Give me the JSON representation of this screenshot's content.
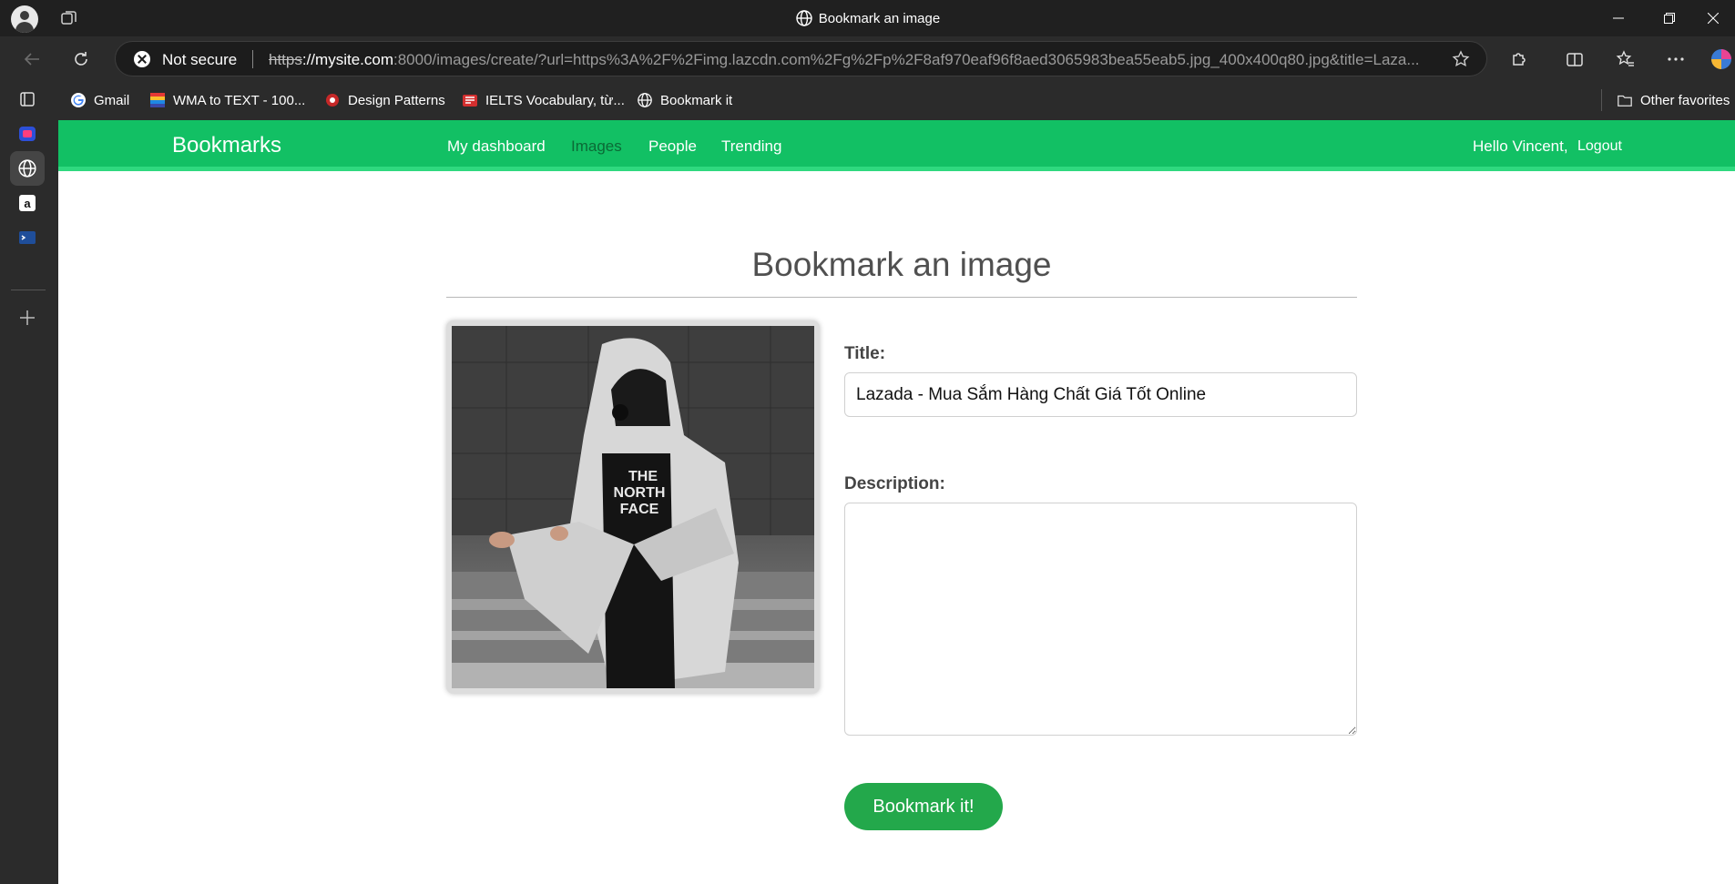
{
  "window": {
    "title": "Bookmark an image"
  },
  "address_bar": {
    "security_label": "Not secure",
    "url_scheme": "https",
    "url_host": "://mysite.com",
    "url_rest": ":8000/images/create/?url=https%3A%2F%2Fimg.lazcdn.com%2Fg%2Fp%2F8af970eaf96f8aed3065983bea55eab5.jpg_400x400q80.jpg&title=Laza..."
  },
  "bookmarks_bar": {
    "items": [
      {
        "label": "Gmail",
        "icon": "google-icon"
      },
      {
        "label": "WMA to TEXT - 100...",
        "icon": "wma-icon"
      },
      {
        "label": "Design Patterns",
        "icon": "design-patterns-icon"
      },
      {
        "label": "IELTS Vocabulary, từ...",
        "icon": "ielts-icon"
      },
      {
        "label": "Bookmark it",
        "icon": "globe-icon"
      }
    ],
    "other_favorites": "Other favorites"
  },
  "site_nav": {
    "brand": "Bookmarks",
    "items": [
      {
        "label": "My dashboard",
        "selected": false
      },
      {
        "label": "Images",
        "selected": true
      },
      {
        "label": "People",
        "selected": false
      },
      {
        "label": "Trending",
        "selected": false
      }
    ],
    "greeting": "Hello Vincent,",
    "logout": "Logout"
  },
  "form": {
    "heading": "Bookmark an image",
    "title_label": "Title:",
    "title_value": "Lazada - Mua Sắm Hàng Chất Giá Tốt Online",
    "description_label": "Description:",
    "description_value": "",
    "submit_label": "Bookmark it!",
    "image_alt": "Man in grey hooded jacket and The North Face t-shirt"
  },
  "photo": {
    "shirt_text_1": "THE",
    "shirt_text_2": "NORTH",
    "shirt_text_3": "FACE"
  },
  "colors": {
    "nav_green": "#12c064",
    "button_green": "#23a84b",
    "chrome_dark": "#202020"
  }
}
